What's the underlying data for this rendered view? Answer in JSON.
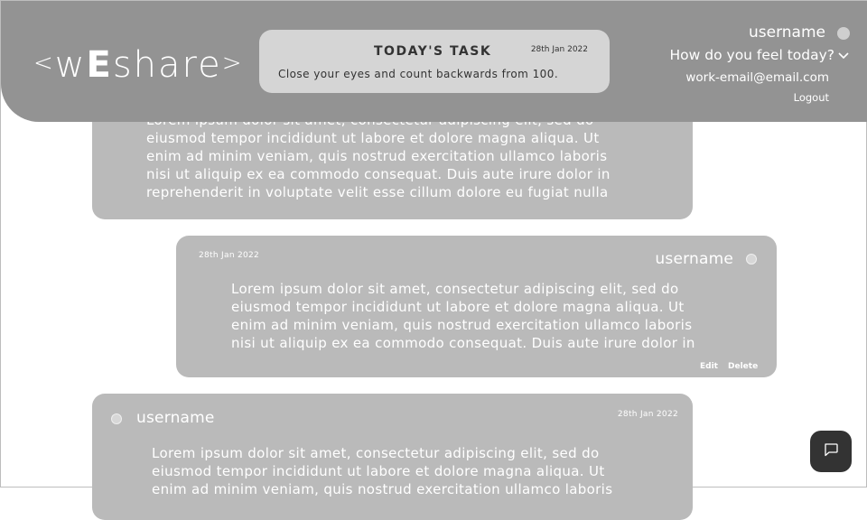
{
  "header": {
    "logo_bracket_left": "<",
    "logo_pre": "w",
    "logo_bold": "E",
    "logo_post": "share",
    "logo_bracket_right": ">",
    "task_title": "TODAY'S TASK",
    "task_date": "28th Jan 2022",
    "task_text": "Close your eyes and count backwards from 100.",
    "username": "username",
    "mood_label": "How do you feel today?",
    "email": "work-email@email.com",
    "logout_label": "Logout"
  },
  "posts": [
    {
      "text": "Lorem ipsum dolor sit amet, consectetur adipiscing elit, sed do\neiusmod tempor incididunt ut labore et dolore magna aliqua. Ut\nenim ad minim veniam, quis nostrud exercitation ullamco laboris\nnisi ut aliquip ex ea commodo consequat. Duis aute irure dolor in\nreprehenderit in voluptate velit esse cillum dolore eu fugiat nulla"
    },
    {
      "date": "28th Jan 2022",
      "username": "username",
      "text": "Lorem ipsum dolor sit amet, consectetur adipiscing elit, sed do\neiusmod tempor incididunt ut labore et dolore magna aliqua. Ut\nenim ad minim veniam, quis nostrud exercitation ullamco laboris\nnisi ut aliquip ex ea commodo consequat. Duis aute irure dolor in",
      "edit_label": "Edit",
      "delete_label": "Delete"
    },
    {
      "username": "username",
      "date": "28th Jan 2022",
      "text": "Lorem ipsum dolor sit amet, consectetur adipiscing elit, sed do\neiusmod tempor incididunt ut labore et dolore magna aliqua. Ut\nenim ad minim veniam, quis nostrud exercitation ullamco laboris"
    }
  ],
  "icons": {
    "chat": "chat-bubble-icon",
    "mood": "chevron-down-icon",
    "avatar": "avatar-dot"
  },
  "colors": {
    "header_bg": "#939393",
    "post_bg": "#bababa",
    "task_bg": "#d5d5d5",
    "chat_button_bg": "#333333"
  }
}
